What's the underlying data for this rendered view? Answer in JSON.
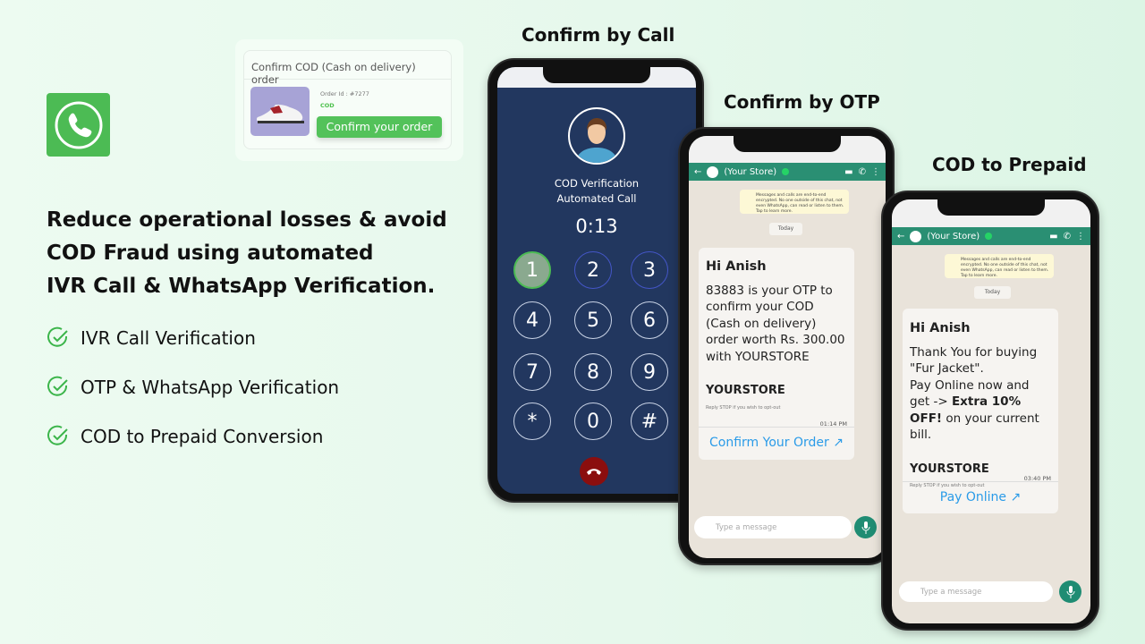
{
  "brand": {
    "icon": "phone-icon",
    "color": "#4cbb54"
  },
  "headline": [
    "Reduce operational losses & avoid",
    "COD Fraud using automated",
    "IVR Call & WhatsApp Verification."
  ],
  "features": [
    "IVR Call Verification",
    "OTP & WhatsApp Verification",
    "COD to Prepaid Conversion"
  ],
  "order_card": {
    "title": "Confirm COD (Cash on delivery) order",
    "order_id": "Order Id : #7277",
    "payment": "COD",
    "button": "Confirm your order"
  },
  "phones": {
    "call": {
      "title": "Confirm by Call",
      "caller_line1": "COD Verification",
      "caller_line2": "Automated Call",
      "timer": "0:13",
      "keys": [
        "1",
        "2",
        "3",
        "4",
        "5",
        "6",
        "7",
        "8",
        "9",
        "*",
        "0",
        "#"
      ]
    },
    "otp": {
      "title": "Confirm by OTP",
      "contact": "(Your Store)",
      "encryption": "Messages and calls are end-to-end encrypted. No one outside of this chat, not even WhatsApp, can read or listen to them. Tap to learn more.",
      "date": "Today",
      "greeting": "Hi Anish",
      "body": "83883 is your OTP to confirm your COD (Cash on delivery) order worth Rs. 300.00 with YOURSTORE",
      "store": "YOURSTORE",
      "optout": "Reply STOP if you wish to opt-out",
      "time": "01:14 PM",
      "action": "Confirm Your Order",
      "placeholder": "Type a message"
    },
    "prepaid": {
      "title": "COD to Prepaid",
      "contact": "(Your Store)",
      "encryption": "Messages and calls are end-to-end encrypted. No one outside of this chat, not even WhatsApp, can read or listen to them. Tap to learn more.",
      "date": "Today",
      "greeting": "Hi Anish",
      "body1": "Thank You for buying \"Fur Jacket\".",
      "body2": "Pay Online now and get -> ",
      "body_bold": "Extra 10% OFF!",
      "body3": " on your current bill.",
      "store": "YOURSTORE",
      "optout": "Reply STOP if you wish to opt-out",
      "time": "03:40 PM",
      "action": "Pay Online",
      "placeholder": "Type a message"
    }
  },
  "colors": {
    "call_bg": "#22375f",
    "wa_header": "#2a8f73",
    "link": "#2a9be8",
    "accent": "#53c25a",
    "end_call": "#8b0e0e"
  }
}
